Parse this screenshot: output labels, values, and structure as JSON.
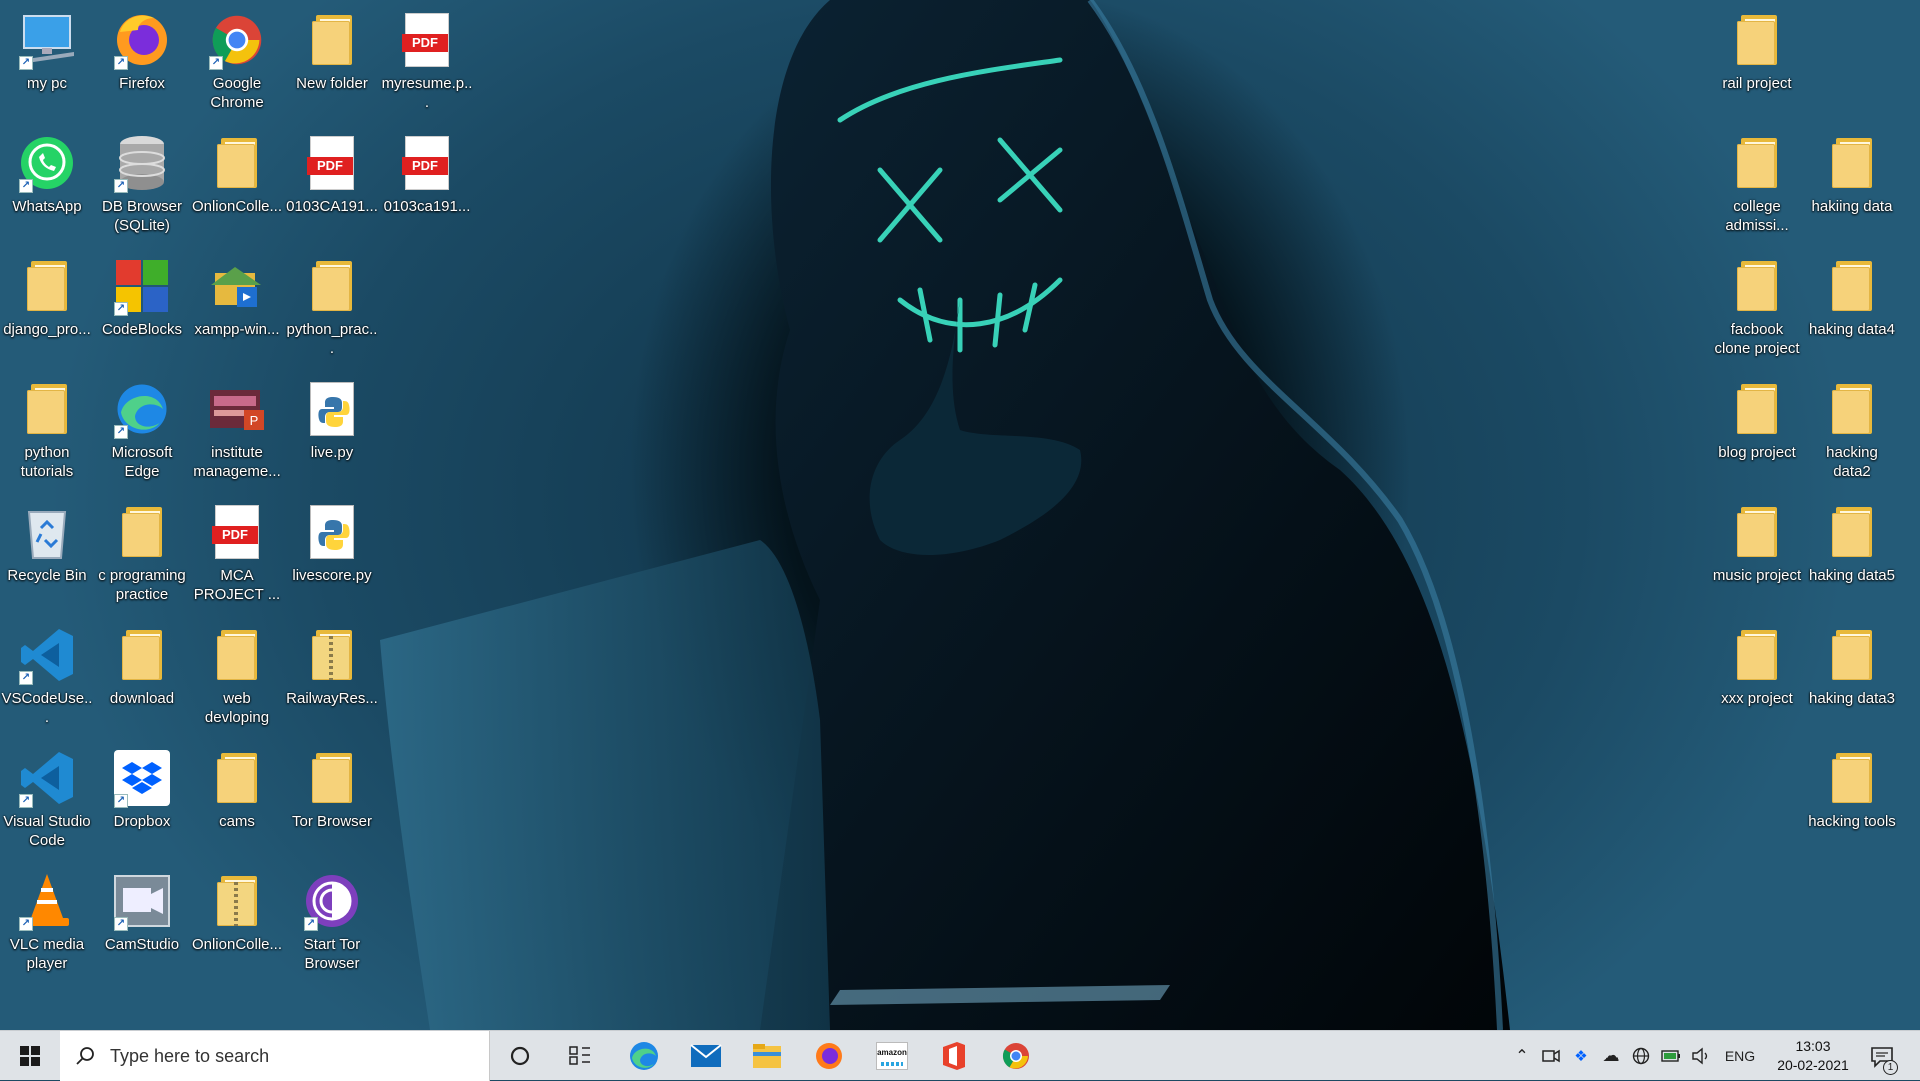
{
  "desktop": {
    "left_icons": [
      {
        "label": "my pc",
        "icon": "computer-icon"
      },
      {
        "label": "Firefox",
        "icon": "firefox-icon"
      },
      {
        "label": "Google Chrome",
        "icon": "chrome-icon"
      },
      {
        "label": "New folder",
        "icon": "folder-icon"
      },
      {
        "label": "myresume.p...",
        "icon": "pdf-icon"
      },
      {
        "label": "WhatsApp",
        "icon": "whatsapp-icon"
      },
      {
        "label": "DB Browser (SQLite)",
        "icon": "database-icon"
      },
      {
        "label": "OnlionColle...",
        "icon": "folder-icon"
      },
      {
        "label": "0103CA191...",
        "icon": "pdf-icon"
      },
      {
        "label": "0103ca191...",
        "icon": "pdf-icon"
      },
      {
        "label": "django_pro...",
        "icon": "folder-icon"
      },
      {
        "label": "CodeBlocks",
        "icon": "codeblocks-icon"
      },
      {
        "label": "xampp-win...",
        "icon": "xampp-installer-icon"
      },
      {
        "label": "python_prac...",
        "icon": "folder-icon"
      },
      {
        "label": "python tutorials",
        "icon": "folder-icon"
      },
      {
        "label": "Microsoft Edge",
        "icon": "edge-icon"
      },
      {
        "label": "institute manageme...",
        "icon": "powerpoint-icon"
      },
      {
        "label": "live.py",
        "icon": "python-file-icon"
      },
      {
        "label": "Recycle Bin",
        "icon": "recycle-bin-icon"
      },
      {
        "label": "c programing practice",
        "icon": "folder-icon"
      },
      {
        "label": "MCA PROJECT ...",
        "icon": "pdf-icon"
      },
      {
        "label": "livescore.py",
        "icon": "python-file-icon"
      },
      {
        "label": "VSCodeUse...",
        "icon": "vscode-icon"
      },
      {
        "label": "download",
        "icon": "folder-icon"
      },
      {
        "label": "web devloping",
        "icon": "folder-icon"
      },
      {
        "label": "RailwayRes...",
        "icon": "zip-folder-icon"
      },
      {
        "label": "Visual Studio Code",
        "icon": "vscode-icon"
      },
      {
        "label": "Dropbox",
        "icon": "dropbox-icon"
      },
      {
        "label": "cams",
        "icon": "folder-icon"
      },
      {
        "label": "Tor Browser",
        "icon": "folder-icon"
      },
      {
        "label": "VLC media player",
        "icon": "vlc-icon"
      },
      {
        "label": "CamStudio",
        "icon": "camstudio-icon"
      },
      {
        "label": "OnlionColle...",
        "icon": "zip-folder-icon"
      },
      {
        "label": "Start Tor Browser",
        "icon": "tor-icon"
      }
    ],
    "right_icons": [
      {
        "label": "rail project",
        "icon": "folder-icon"
      },
      {
        "label": "college admissi...",
        "icon": "folder-icon"
      },
      {
        "label": "hakiing data",
        "icon": "folder-icon"
      },
      {
        "label": "facbook clone project",
        "icon": "folder-icon"
      },
      {
        "label": "haking data4",
        "icon": "folder-icon"
      },
      {
        "label": "blog project",
        "icon": "folder-icon"
      },
      {
        "label": "hacking data2",
        "icon": "folder-icon"
      },
      {
        "label": "music project",
        "icon": "folder-icon"
      },
      {
        "label": "haking data5",
        "icon": "folder-icon"
      },
      {
        "label": "xxx project",
        "icon": "folder-icon"
      },
      {
        "label": "haking data3",
        "icon": "folder-icon"
      },
      {
        "label": "hacking tools",
        "icon": "folder-icon"
      }
    ]
  },
  "taskbar": {
    "search_placeholder": "Type here to search",
    "pinned": [
      "edge-icon",
      "mail-icon",
      "file-explorer-icon",
      "firefox-icon",
      "amazon-icon",
      "office-icon",
      "chrome-icon"
    ],
    "amazon_label": "amazon",
    "language": "ENG",
    "time": "13:03",
    "date": "20-02-2021",
    "notification_count": "1"
  },
  "colors": {
    "folder": "#f6d27a",
    "taskbar": "#dfe3e7",
    "pdf_red": "#e02020"
  }
}
